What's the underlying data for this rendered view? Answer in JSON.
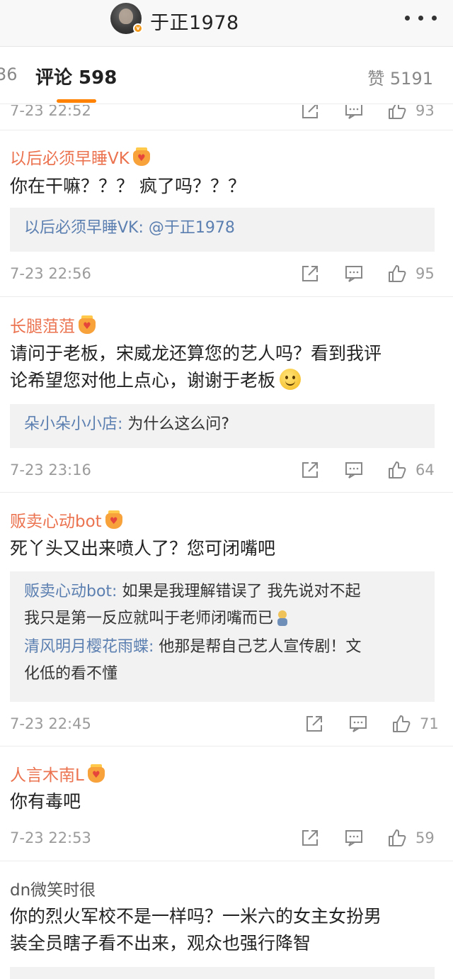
{
  "header": {
    "title": "于正1978",
    "verified_badge": "v"
  },
  "tabs": {
    "prev_partial": "36",
    "comments": "评论 598",
    "likes": "赞 5191"
  },
  "colors": {
    "accent": "#ff8200",
    "username": "#eb7350",
    "reply_name": "#5b7fb0",
    "muted": "#9b9b9b"
  },
  "comments": [
    {
      "time": "7-23 22:52",
      "likes": "93"
    },
    {
      "username": "以后必须早睡VK",
      "text": "你在干嘛？？？ 疯了吗？？？",
      "reply_name": "以后必须早睡VK:",
      "reply_text": " @于正1978",
      "time": "7-23 22:56",
      "likes": "95"
    },
    {
      "username": "长腿菹菹",
      "text_line1": "请问于老板，宋威龙还算您的艺人吗？看到我评",
      "text_line2": "论希望您对他上点心，谢谢于老板",
      "reply_name": "朵小朵小小店:",
      "reply_text": " 为什么这么问?",
      "time": "7-23 23:16",
      "likes": "64"
    },
    {
      "username": "贩卖心动bot",
      "text": "死丫头又出来喷人了？您可闭嘴吧",
      "reply1_name": "贩卖心动bot:",
      "reply1_text_line1": " 如果是我理解错误了 我先说对不起",
      "reply1_text_line2": "我只是第一反应就叫于老师闭嘴而已",
      "reply2_name": "清风明月樱花雨蝶:",
      "reply2_text_line1": " 他那是帮自己艺人宣传剧！文",
      "reply2_text_line2": "化低的看不懂",
      "time": "7-23 22:45",
      "likes": "71"
    },
    {
      "username": "人言木南L",
      "text": "你有毒吧",
      "time": "7-23 22:53",
      "likes": "59"
    },
    {
      "username": "dn微笑时很",
      "text_line1": "你的烈火军校不是一样吗？一米六的女主女扮男",
      "text_line2": "装全员瞎子看不出来，观众也强行降智"
    }
  ],
  "icons": {
    "share": "share-icon",
    "comment": "comment-icon",
    "like": "like-icon",
    "more": "more-icon",
    "fan_badge": "fan-badge-icon"
  }
}
